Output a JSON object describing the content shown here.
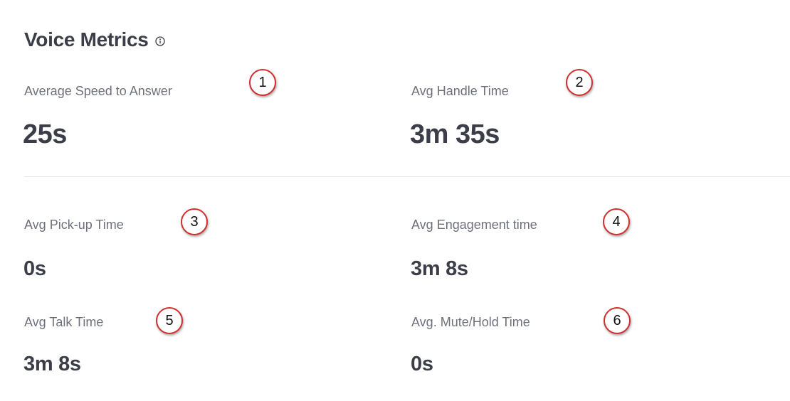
{
  "section": {
    "title": "Voice Metrics",
    "info_icon": "info-circle-icon"
  },
  "metrics": [
    {
      "label": "Average Speed to Answer",
      "value": "25s",
      "annotation": "1"
    },
    {
      "label": "Avg Handle Time",
      "value": "3m 35s",
      "annotation": "2"
    },
    {
      "label": "Avg Pick-up Time",
      "value": "0s",
      "annotation": "3"
    },
    {
      "label": "Avg Engagement time",
      "value": "3m 8s",
      "annotation": "4"
    },
    {
      "label": "Avg Talk Time",
      "value": "3m 8s",
      "annotation": "5"
    },
    {
      "label": "Avg. Mute/Hold Time",
      "value": "0s",
      "annotation": "6"
    }
  ],
  "colors": {
    "annotation_ring": "#d32f2f",
    "title_text": "#3b3e48",
    "label_text": "#6d717b",
    "divider": "#e3e4e8"
  }
}
